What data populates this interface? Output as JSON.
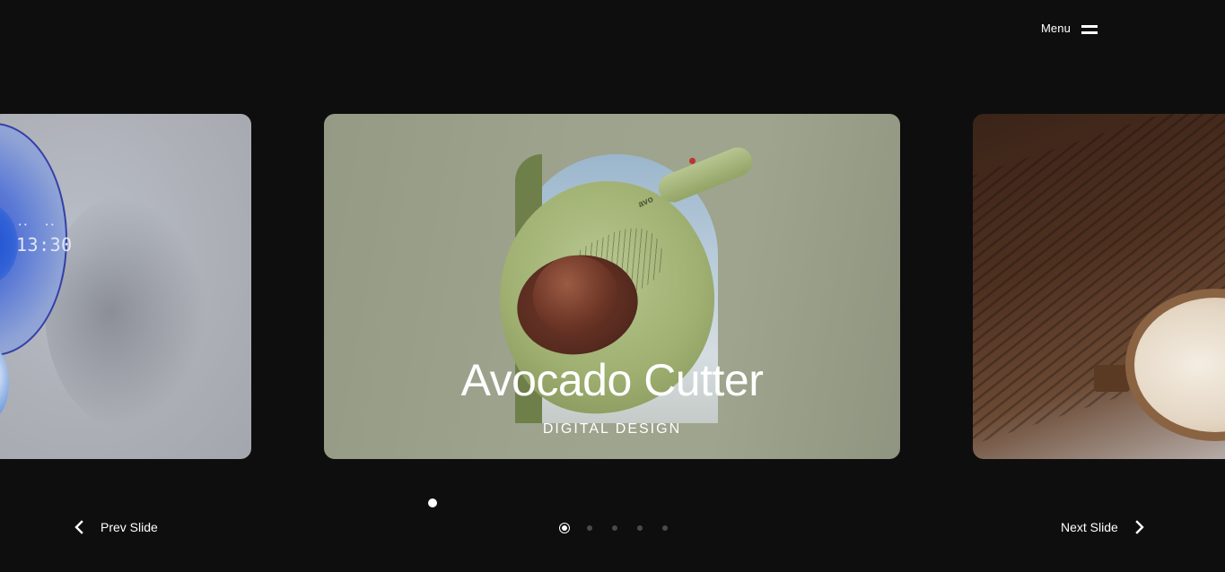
{
  "header": {
    "menu_label": "Menu",
    "menu_icon": "hamburger-icon"
  },
  "slides": {
    "previous": {
      "clock_display": "13:30",
      "clock_indicator_left": "••",
      "clock_indicator_right": "••"
    },
    "current": {
      "title": "Avocado Cutter",
      "category": "DIGITAL DESIGN",
      "brand_mark": "avo"
    }
  },
  "pagination": {
    "count": 5,
    "active_index": 0
  },
  "nav": {
    "prev_label": "Prev Slide",
    "prev_icon": "chevron-left-icon",
    "next_label": "Next Slide",
    "next_icon": "chevron-right-icon"
  },
  "colors": {
    "background": "#0e0e0e",
    "text": "#ffffff",
    "inactive_dot": "#4a4a4a"
  }
}
